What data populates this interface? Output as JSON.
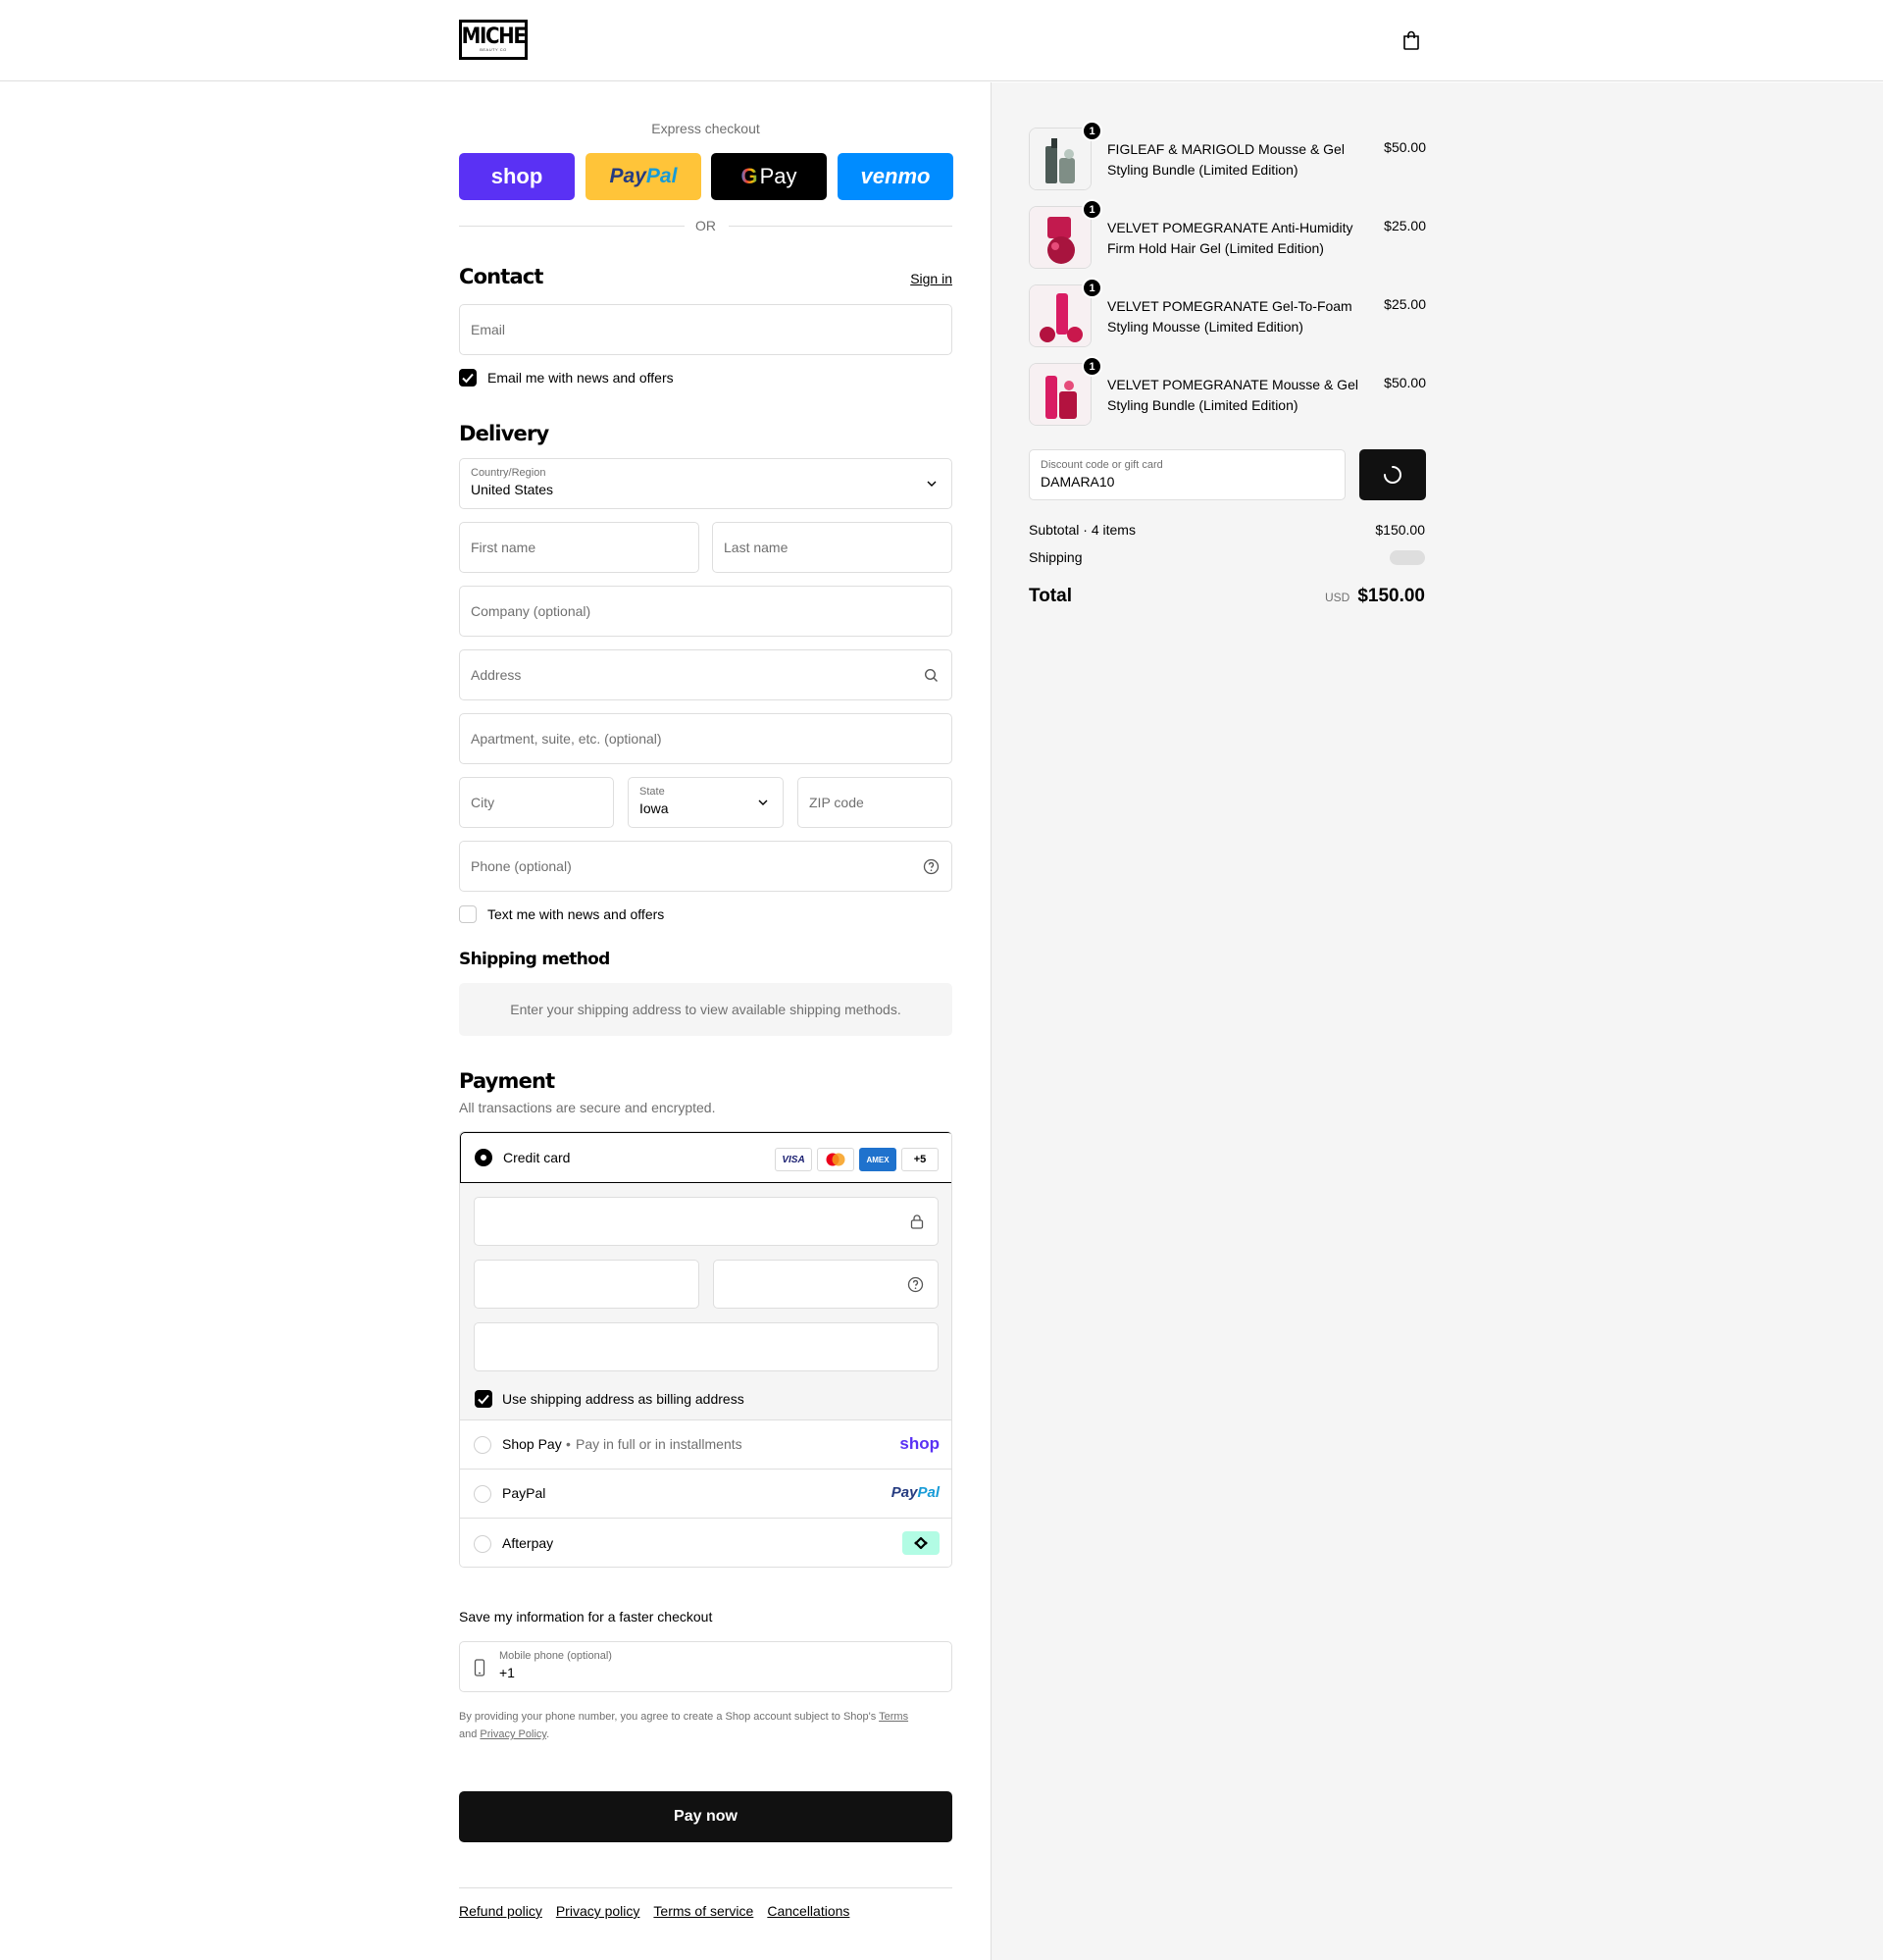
{
  "header": {
    "logo_text": "MICHE",
    "logo_subtext": "BEAUTY CO"
  },
  "express": {
    "title": "Express checkout",
    "shop": "shop",
    "paypal_pay": "Pay",
    "paypal_pal": "Pal",
    "gpay": "Pay",
    "venmo": "venmo",
    "or": "OR"
  },
  "contact": {
    "title": "Contact",
    "sign_in": "Sign in",
    "email_placeholder": "Email",
    "news_label": "Email me with news and offers",
    "news_checked": true
  },
  "delivery": {
    "title": "Delivery",
    "country_label": "Country/Region",
    "country_value": "United States",
    "first_name": "First name",
    "last_name": "Last name",
    "company": "Company (optional)",
    "address": "Address",
    "apartment": "Apartment, suite, etc. (optional)",
    "city": "City",
    "state_label": "State",
    "state_value": "Iowa",
    "zip": "ZIP code",
    "phone": "Phone (optional)",
    "text_label": "Text me with news and offers",
    "text_checked": false
  },
  "shipping": {
    "title": "Shipping method",
    "notice": "Enter your shipping address to view available shipping methods."
  },
  "payment": {
    "title": "Payment",
    "subtitle": "All transactions are secure and encrypted.",
    "credit_card": "Credit card",
    "cards": [
      "VISA",
      "MC",
      "AMEX",
      "+5"
    ],
    "billing_label": "Use shipping address as billing address",
    "shop_pay": "Shop Pay",
    "shop_pay_sub": "Pay in full or in installments",
    "shop_pay_logo": "shop",
    "paypal": "PayPal",
    "paypal_logo_pay": "Pay",
    "paypal_logo_pal": "Pal",
    "afterpay": "Afterpay"
  },
  "save": {
    "title": "Save my information for a faster checkout",
    "mobile_label": "Mobile phone (optional)",
    "mobile_value": "+1",
    "legal_prefix": "By providing your phone number, you agree to create a Shop account subject to Shop's ",
    "terms": "Terms",
    "and": "and ",
    "privacy": "Privacy Policy",
    "dot": "."
  },
  "pay_now": "Pay now",
  "footer": [
    "Refund policy",
    "Privacy policy",
    "Terms of service",
    "Cancellations"
  ],
  "cart": {
    "items": [
      {
        "name": "FIGLEAF & MARIGOLD Mousse & Gel Styling Bundle (Limited Edition)",
        "price": "$50.00",
        "qty": "1"
      },
      {
        "name": "VELVET POMEGRANATE Anti-Humidity Firm Hold Hair Gel (Limited Edition)",
        "price": "$25.00",
        "qty": "1"
      },
      {
        "name": "VELVET POMEGRANATE Gel-To-Foam Styling Mousse (Limited Edition)",
        "price": "$25.00",
        "qty": "1"
      },
      {
        "name": "VELVET POMEGRANATE Mousse & Gel Styling Bundle (Limited Edition)",
        "price": "$50.00",
        "qty": "1"
      }
    ],
    "discount_label": "Discount code or gift card",
    "discount_value": "DAMARA10",
    "subtotal_label": "Subtotal · 4 items",
    "subtotal": "$150.00",
    "shipping_label": "Shipping",
    "total_label": "Total",
    "currency": "USD",
    "total": "$150.00"
  }
}
